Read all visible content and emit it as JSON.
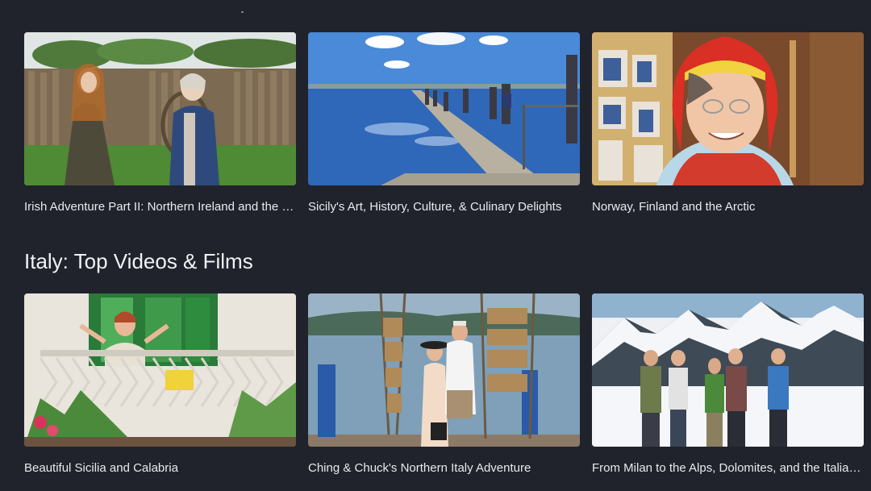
{
  "colors": {
    "background": "#20232c",
    "text_primary": "#e9eaee",
    "heading": "#f1f2f5"
  },
  "top_row": {
    "videos": [
      {
        "title": "Irish Adventure Part II: Northern Ireland and the Republic of Ireland",
        "thumbnail": "two women in costume by a wooden fence"
      },
      {
        "title": "Sicily's Art, History, Culture, & Culinary Delights",
        "thumbnail": "people walking on a causeway by salt pans"
      },
      {
        "title": "Norway, Finland and the Arctic",
        "thumbnail": "smiling woman in red Sami hat"
      }
    ]
  },
  "section": {
    "heading": "Italy: Top Videos & Films"
  },
  "bottom_row": {
    "videos": [
      {
        "title": "Beautiful Sicilia and Calabria",
        "thumbnail": "woman on a balcony with green shutters"
      },
      {
        "title": "Ching & Chuck's Northern Italy Adventure",
        "thumbnail": "couple by a lake with drying fish racks"
      },
      {
        "title": "From Milan to the Alps, Dolomites, and the Italian Lakes",
        "thumbnail": "hikers in front of snowy mountains"
      }
    ]
  }
}
